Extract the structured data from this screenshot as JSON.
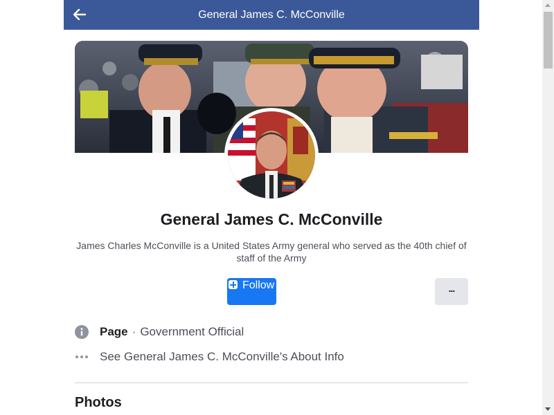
{
  "header": {
    "title": "General James C. McConville",
    "back_icon": "arrow-left-icon",
    "background_color": "#3b5998"
  },
  "profile": {
    "name": "General James C. McConville",
    "description": "James Charles McConville is a United States Army general who served as the 40th chief of staff of the Army"
  },
  "actions": {
    "follow_label": "Follow",
    "follow_icon": "plus-square-icon",
    "more_label": "...",
    "accent_color": "#1877f2"
  },
  "info": {
    "page_type_label": "Page",
    "separator": "·",
    "category": "Government Official",
    "info_icon": "info-circle-icon",
    "about_link": "See General James C. McConville's About Info",
    "about_icon": "ellipsis-icon"
  },
  "sections": {
    "photos_title": "Photos"
  }
}
